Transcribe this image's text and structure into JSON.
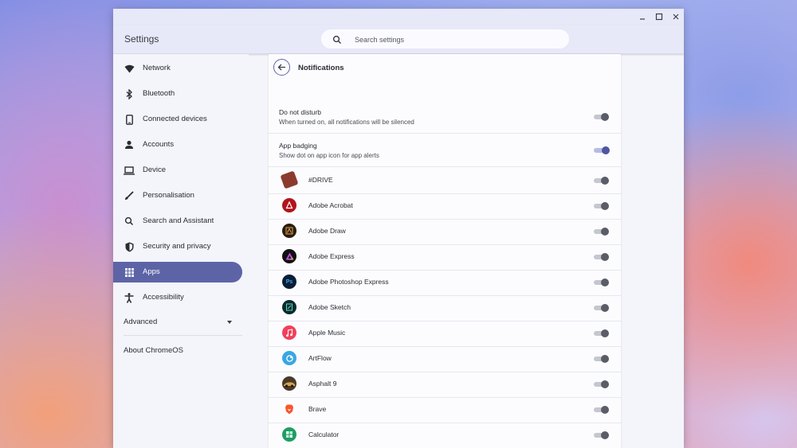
{
  "window": {
    "title": "Settings"
  },
  "search": {
    "placeholder": "Search settings"
  },
  "sidebar": {
    "items": [
      {
        "label": "Network",
        "icon": "wifi-icon",
        "active": false
      },
      {
        "label": "Bluetooth",
        "icon": "bluetooth-icon",
        "active": false
      },
      {
        "label": "Connected devices",
        "icon": "phone-icon",
        "active": false
      },
      {
        "label": "Accounts",
        "icon": "person-icon",
        "active": false
      },
      {
        "label": "Device",
        "icon": "laptop-icon",
        "active": false
      },
      {
        "label": "Personalisation",
        "icon": "brush-icon",
        "active": false
      },
      {
        "label": "Search and Assistant",
        "icon": "search-icon",
        "active": false
      },
      {
        "label": "Security and privacy",
        "icon": "shield-icon",
        "active": false
      },
      {
        "label": "Apps",
        "icon": "apps-grid-icon",
        "active": true
      },
      {
        "label": "Accessibility",
        "icon": "accessibility-icon",
        "active": false
      }
    ],
    "advanced_label": "Advanced",
    "about_label": "About ChromeOS"
  },
  "page": {
    "title": "Notifications",
    "dnd": {
      "title": "Do not disturb",
      "subtitle": "When turned on, all notifications will be silenced",
      "on": false
    },
    "badging": {
      "title": "App badging",
      "subtitle": "Show dot on app icon for app alerts",
      "on": true
    }
  },
  "apps": [
    {
      "name": "#DRIVE",
      "icon": "drive-game-icon",
      "color": "#8a3b2e",
      "glyph": "",
      "on": false
    },
    {
      "name": "Adobe Acrobat",
      "icon": "acrobat-icon",
      "color": "#b3141c",
      "glyph": "",
      "on": false
    },
    {
      "name": "Adobe Draw",
      "icon": "adobe-draw-icon",
      "color": "#2b1d0e",
      "glyph": "",
      "on": false
    },
    {
      "name": "Adobe Express",
      "icon": "adobe-express-icon",
      "color": "#111111",
      "glyph": "",
      "on": false
    },
    {
      "name": "Adobe Photoshop Express",
      "icon": "photoshop-express-icon",
      "color": "#0b1e33",
      "glyph": "Ps",
      "on": false
    },
    {
      "name": "Adobe Sketch",
      "icon": "adobe-sketch-icon",
      "color": "#0b2a2b",
      "glyph": "",
      "on": false
    },
    {
      "name": "Apple Music",
      "icon": "apple-music-icon",
      "color": "#f2405a",
      "glyph": "",
      "on": false
    },
    {
      "name": "ArtFlow",
      "icon": "artflow-icon",
      "color": "#3aa7e0",
      "glyph": "",
      "on": false
    },
    {
      "name": "Asphalt 9",
      "icon": "asphalt-9-icon",
      "color": "#4a3a2a",
      "glyph": "",
      "on": false
    },
    {
      "name": "Brave",
      "icon": "brave-icon",
      "color": "#ffffff",
      "glyph": "",
      "on": false
    },
    {
      "name": "Calculator",
      "icon": "calculator-icon",
      "color": "#1e9e63",
      "glyph": "",
      "on": false
    }
  ]
}
